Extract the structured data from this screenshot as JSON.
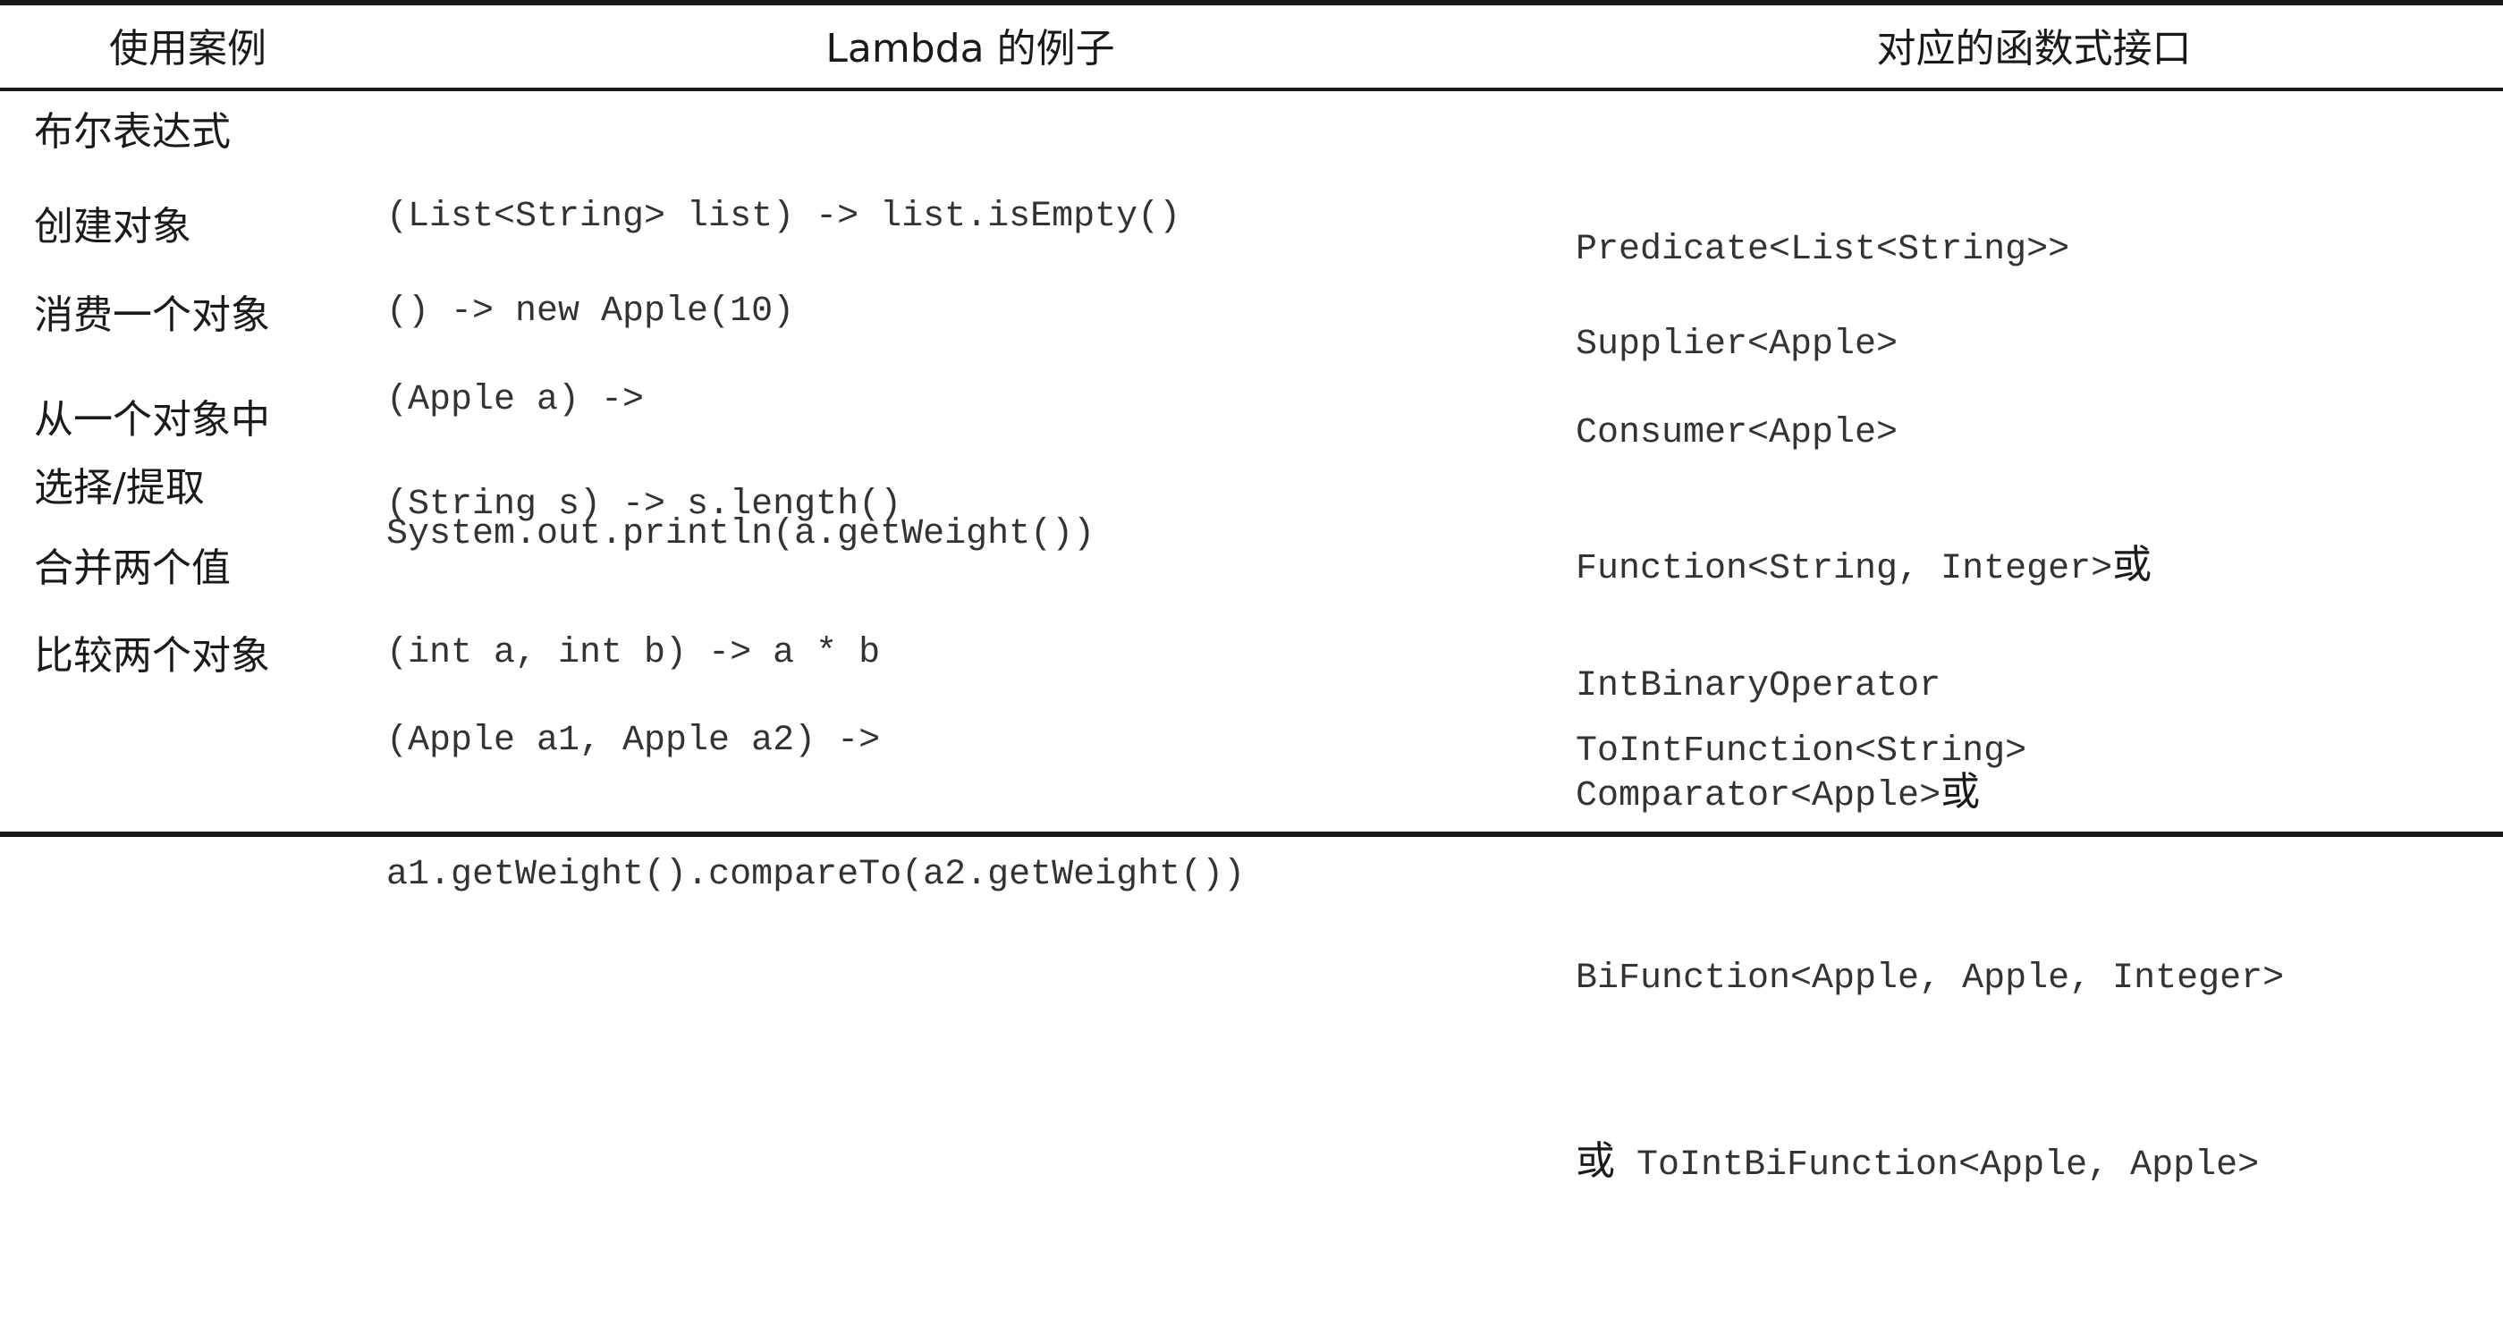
{
  "headers": {
    "usecase": "使用案例",
    "example": "Lambda 的例子",
    "iface": "对应的函数式接口"
  },
  "rows": [
    {
      "usecase": [
        "布尔表达式"
      ],
      "example": [
        "(List<String> list) -> list.isEmpty()"
      ],
      "iface": [
        {
          "code": "Predicate<List<String>>",
          "suffix": ""
        }
      ]
    },
    {
      "usecase": [
        "创建对象"
      ],
      "example": [
        "() -> new Apple(10)"
      ],
      "iface": [
        {
          "code": "Supplier<Apple>",
          "suffix": ""
        }
      ]
    },
    {
      "usecase": [
        "消费一个对象"
      ],
      "example": [
        "(Apple a) ->",
        "System.out.println(a.getWeight())"
      ],
      "iface": [
        {
          "code": "Consumer<Apple>",
          "suffix": ""
        }
      ]
    },
    {
      "usecase": [
        "从一个对象中",
        "选择/提取"
      ],
      "example": [
        "(String s) -> s.length()"
      ],
      "iface": [
        {
          "code": "Function<String, Integer>",
          "suffix": "或"
        },
        {
          "code": "ToIntFunction<String>",
          "suffix": ""
        }
      ]
    },
    {
      "usecase": [
        "合并两个值"
      ],
      "example": [
        "(int a, int b) -> a * b"
      ],
      "iface": [
        {
          "code": "IntBinaryOperator",
          "suffix": ""
        }
      ]
    },
    {
      "usecase": [
        "比较两个对象"
      ],
      "example": [
        "(Apple a1, Apple a2) ->",
        "a1.getWeight().compareTo(a2.getWeight())"
      ],
      "iface": [
        {
          "code": "Comparator<Apple>",
          "suffix": "或"
        },
        {
          "code": "BiFunction<Apple, Apple, Integer>",
          "suffix": ""
        },
        {
          "prefix": "或",
          "code": " ToIntBiFunction<Apple, Apple>",
          "suffix": ""
        }
      ]
    }
  ]
}
